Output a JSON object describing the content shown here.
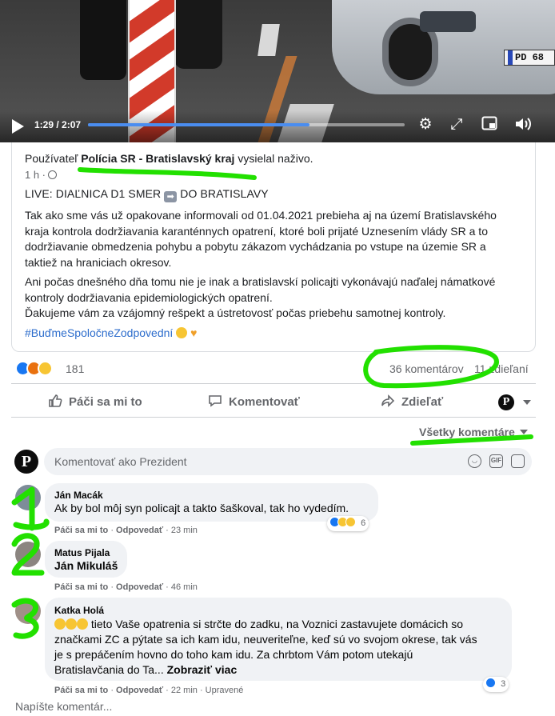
{
  "video": {
    "time": "1:29 / 2:07",
    "progress_fraction": 0.7,
    "plate_text": "PD 68",
    "icons": [
      "play-icon",
      "gear-icon",
      "fullscreen-icon",
      "pip-icon",
      "volume-icon"
    ]
  },
  "post": {
    "live_prefix": "Používateľ",
    "page_name": "Polícia SR - Bratislavský kraj",
    "live_suffix": "vysielal naživo.",
    "age": "1 h ·",
    "title_left": "LIVE: DIAĽNICA D1 SMER",
    "title_right": "DO BRATISLAVY",
    "paragraph1": "Tak ako sme vás už opakovane informovali od 01.04.2021 prebieha aj na území Bratislavského kraja kontrola dodržiavania karanténnych opatrení, ktoré boli prijaté Uznesením vlády SR a to dodržiavanie obmedzenia pohybu a pobytu zákazom vychádzania po vstupe na územie SR a taktiež na hraniciach okresov.",
    "paragraph2": "Ani počas dnešného dňa tomu nie je inak a bratislavskí policajti vykonávajú naďalej námatkové kontroly dodržiavania epidemiologických opatrení.\nĎakujeme vám za vzájomný rešpekt a ústretovosť počas priebehu samotnej kontroly.",
    "hashtag": "#BuďmeSpoločneZodpovední"
  },
  "stats": {
    "reaction_count": "181",
    "comments": "36 komentárov",
    "shares": "11 zdieľaní"
  },
  "actions": {
    "like": "Páči sa mi to",
    "comment": "Komentovať",
    "share": "Zdieľať"
  },
  "sort_label": "Všetky komentáre",
  "composer_placeholder": "Komentovať ako Prezident",
  "comments": [
    {
      "name": "Ján Macák",
      "text": "Ak by bol môj syn policajt a takto šaškoval, tak ho vydedím.",
      "like": "Páči sa mi to",
      "reply": "Odpovedať",
      "time": "· 23 min",
      "reactions": "6"
    },
    {
      "name": "Matus Pijala",
      "text": "Ján Mikuláš",
      "like": "Páči sa mi to",
      "reply": "Odpovedať",
      "time": "· 46 min"
    },
    {
      "name": "Katka Holá",
      "text_line1": "tieto Vaše opatrenia si strčte do zadku, na Voznici zastavujete domácich so",
      "text_line2": "značkami ZC a pýtate sa ich kam idu, neuveriteľne, keď sú vo svojom okrese, tak vás",
      "text_line3": "je s prepáčením hovno do toho kam idu. Za chrbtom Vám potom utekajú",
      "text_line4": "Bratislavčania do Ta...",
      "see_more": "Zobraziť viac",
      "like": "Páči sa mi to",
      "reply": "Odpovedať",
      "time": "· 22 min · Upravené",
      "reactions": "3"
    }
  ],
  "write_placeholder": "Napíšte komentár...",
  "annotations": [
    "1",
    "2",
    "3"
  ],
  "colors": {
    "fb_blue": "#1877f2",
    "link_blue": "#2d6dcc",
    "marker_green": "#22e000",
    "bubble": "#f0f2f5",
    "muted": "#65676b"
  }
}
